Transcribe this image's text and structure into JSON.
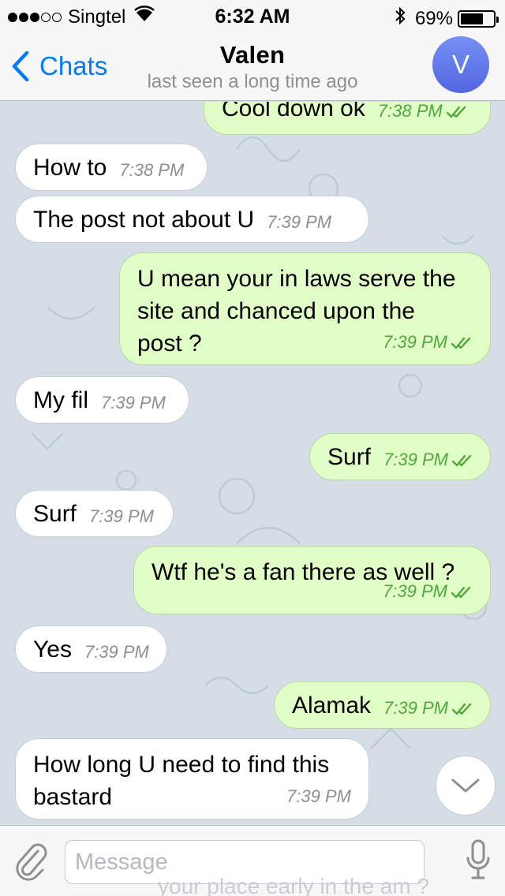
{
  "status_bar": {
    "carrier": "Singtel",
    "time": "6:32 AM",
    "battery": "69%",
    "battery_level": 0.69,
    "signal_bars_filled": 3,
    "signal_bars_total": 5
  },
  "nav": {
    "back_label": "Chats",
    "title": "Valen",
    "subtitle": "last seen a long time ago",
    "avatar_initial": "V",
    "accent_color": "#007aff"
  },
  "messages": [
    {
      "dir": "out",
      "lines": [
        "Cool down ok"
      ],
      "time": "7:38 PM",
      "read": true
    },
    {
      "dir": "in",
      "lines": [
        "How to"
      ],
      "time": "7:38 PM"
    },
    {
      "dir": "in",
      "lines": [
        "The post not about U"
      ],
      "time": "7:39 PM"
    },
    {
      "dir": "out",
      "lines": [
        "U mean your in laws serve the",
        "site and chanced upon the",
        "post ?"
      ],
      "time": "7:39 PM",
      "read": true
    },
    {
      "dir": "in",
      "lines": [
        "My fil"
      ],
      "time": "7:39 PM"
    },
    {
      "dir": "out",
      "lines": [
        "Surf"
      ],
      "time": "7:39 PM",
      "read": true
    },
    {
      "dir": "in",
      "lines": [
        "Surf"
      ],
      "time": "7:39 PM"
    },
    {
      "dir": "out",
      "lines": [
        "Wtf he's a fan there as well ?"
      ],
      "time": "7:39 PM",
      "read": true
    },
    {
      "dir": "in",
      "lines": [
        "Yes"
      ],
      "time": "7:39 PM"
    },
    {
      "dir": "out",
      "lines": [
        "Alamak"
      ],
      "time": "7:39 PM",
      "read": true
    },
    {
      "dir": "in",
      "lines": [
        "How long U need to find this",
        "bastard"
      ],
      "time": "7:39 PM"
    }
  ],
  "input": {
    "placeholder": "Message",
    "ghost_text": "your place early in the am ?"
  },
  "icons": {
    "back": "chevron-left-icon",
    "attach": "paperclip-icon",
    "mic": "microphone-icon",
    "scroll": "chevron-down-icon",
    "read": "double-check-icon"
  }
}
